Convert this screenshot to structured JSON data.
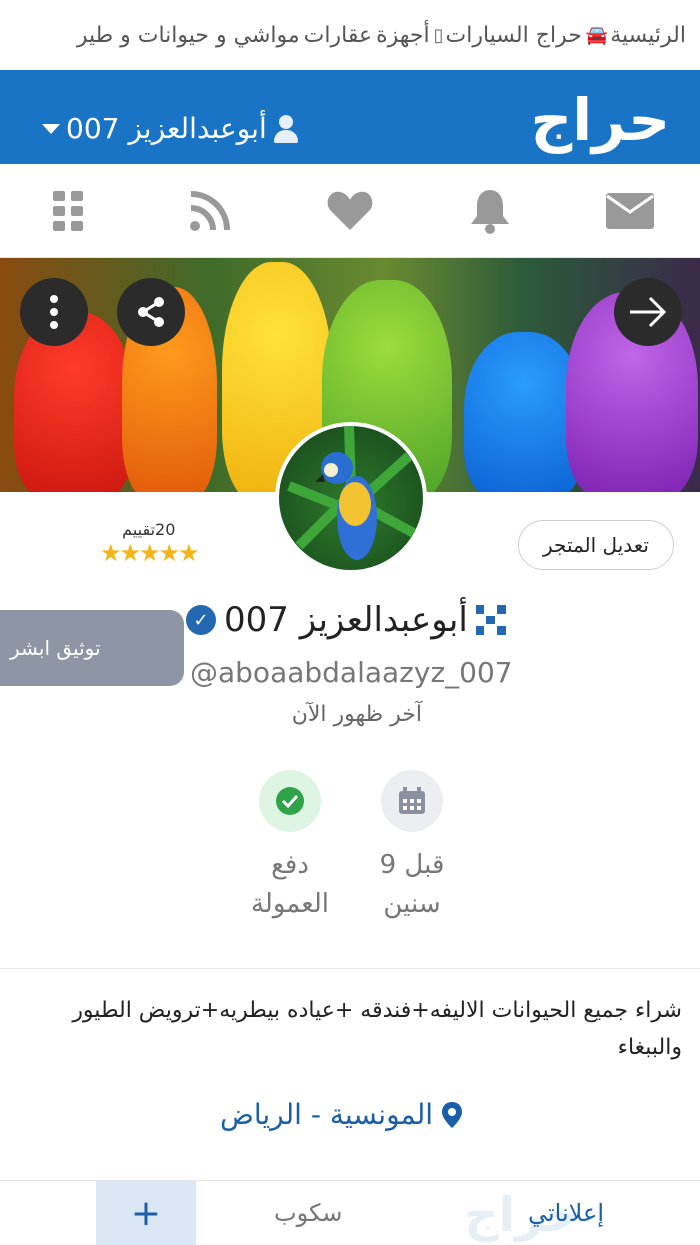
{
  "topnav": {
    "items": [
      {
        "label": "الرئيسية",
        "icon": "car-icon"
      },
      {
        "label": "حراج السيارات",
        "icon": "phone-icon"
      },
      {
        "label": "أجهزة",
        "icon": ""
      },
      {
        "label": "عقارات",
        "icon": ""
      },
      {
        "label": "مواشي و حيوانات و طير",
        "icon": ""
      }
    ]
  },
  "header": {
    "logo_text": "حراج",
    "user_label": "أبوعبدالعزيز 007",
    "bg_color": "#1a74c6"
  },
  "iconbar": {
    "icons": [
      "mail-icon",
      "bell-icon",
      "heart-icon",
      "rss-icon",
      "grid-icon"
    ]
  },
  "profile": {
    "rating_count": "20تقييم",
    "stars": "★★★★★",
    "edit_store": "تعديل المتجر",
    "verify_absher": "توثيق ابشر",
    "username": "أبوعبدالعزيز 007",
    "handle": "@aboaabdalaazyz_007",
    "last_seen": "آخر ظهور الآن",
    "stats": [
      {
        "line1": "قبل 9",
        "line2": "سنين",
        "icon": "calendar-icon"
      },
      {
        "line1": "دفع",
        "line2": "العمولة",
        "icon": "check-badge-icon"
      }
    ],
    "description": "شراء جميع الحيوانات الاليفه+فندقه +عياده بيطريه+ترويض الطيور والببغاء",
    "location": "المونسية - الرياض"
  },
  "bottombar": {
    "plus": "+",
    "scoob": "سكوب",
    "my_ads": "إعلاناتي",
    "watermark": "حراج"
  }
}
